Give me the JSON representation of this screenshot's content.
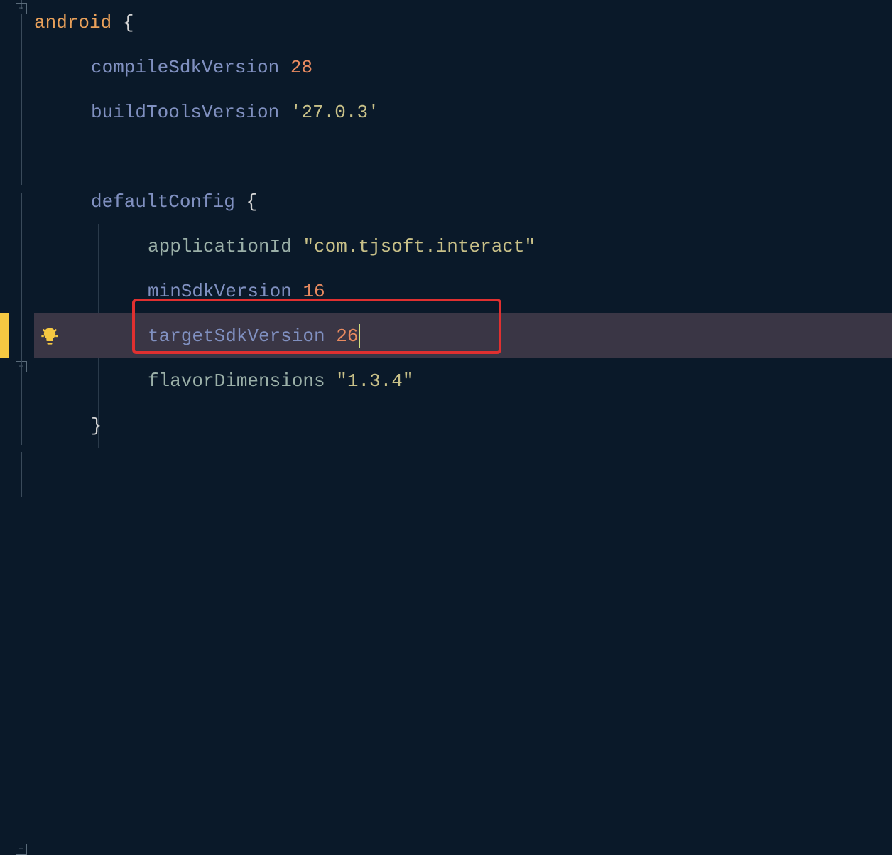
{
  "code": {
    "line1": {
      "keyword": "android",
      "space": " ",
      "brace": "{"
    },
    "line2": {
      "prop": "compileSdkVersion",
      "space": " ",
      "value": "28"
    },
    "line3": {
      "prop": "buildToolsVersion",
      "space": " ",
      "value": "'27.0.3'"
    },
    "line5": {
      "prop": "defaultConfig",
      "space": " ",
      "brace": "{"
    },
    "line6": {
      "prop": "applicationId",
      "space": " ",
      "value": "\"com.tjsoft.interact\""
    },
    "line7": {
      "prop": "minSdkVersion",
      "space": " ",
      "value": "16"
    },
    "line8": {
      "prop": "targetSdkVersion",
      "space": " ",
      "value": "26"
    },
    "line9": {
      "prop": "flavorDimensions",
      "space": " ",
      "value": "\"1.3.4\""
    },
    "line10": {
      "brace": "}"
    }
  }
}
